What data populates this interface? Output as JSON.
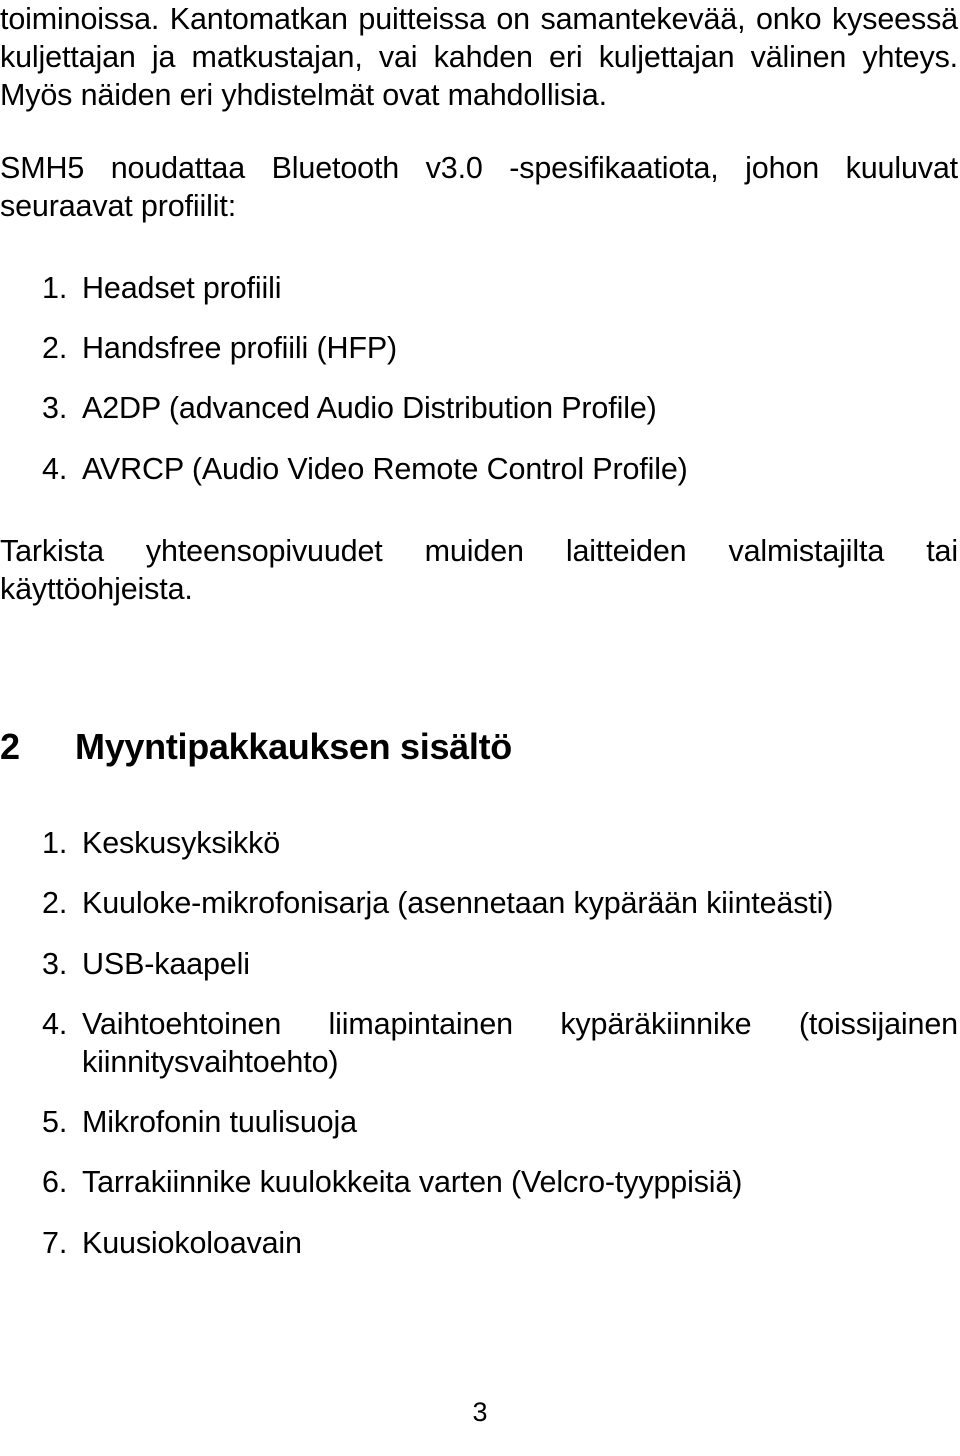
{
  "page": {
    "number": "3",
    "language": "fi",
    "text_color": "#000000",
    "background_color": "#ffffff"
  },
  "paragraphs": {
    "continued_intro": "toiminoissa. Kantomatkan puitteissa on samantekevää, onko kyseessä kuljettajan ja matkustajan, vai kahden eri kuljettajan välinen yhteys. Myös näiden eri yhdistelmät ovat mahdollisia.",
    "bluetooth_spec": "SMH5 noudattaa Bluetooth v3.0 -spesifikaatiota, johon kuuluvat seuraavat profiilit:",
    "compatibility_note": "Tarkista yhteensopivuudet muiden laitteiden valmistajilta tai käyttöohjeista."
  },
  "profile_list": {
    "items": [
      {
        "number": "1.",
        "label": "Headset profiili"
      },
      {
        "number": "2.",
        "label": "Handsfree profiili (HFP)"
      },
      {
        "number": "3.",
        "label": "A2DP (advanced Audio Distribution Profile)"
      },
      {
        "number": "4.",
        "label": "AVRCP (Audio Video Remote Control Profile)"
      }
    ]
  },
  "section": {
    "number": "2",
    "title": "Myyntipakkauksen sisältö"
  },
  "package_contents_list": {
    "items": [
      {
        "number": "1.",
        "label": "Keskusyksikkö"
      },
      {
        "number": "2.",
        "label": "Kuuloke-mikrofonisarja (asennetaan kypärään kiinteästi)"
      },
      {
        "number": "3.",
        "label": "USB-kaapeli"
      },
      {
        "number": "4.",
        "label": "Vaihtoehtoinen liimapintainen kypäräkiinnike (toissijainen kiinnitysvaihtoehto)"
      },
      {
        "number": "5.",
        "label": "Mikrofonin tuulisuoja"
      },
      {
        "number": "6.",
        "label": "Tarrakiinnike kuulokkeita varten (Velcro-tyyppisiä)"
      },
      {
        "number": "7.",
        "label": "Kuusiokoloavain"
      }
    ]
  }
}
